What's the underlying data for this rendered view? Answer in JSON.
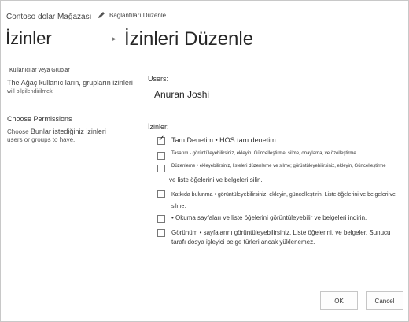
{
  "header": {
    "site_title": "Contoso dolar Mağazası",
    "edit_links": "Bağlantıları Düzenle...",
    "page_title_left": "İzinler",
    "page_title": "İzinleri Düzenle"
  },
  "left": {
    "section1_title": "Kullanıcılar veya Gruplar",
    "section1_desc_lead": "The",
    "section1_desc_rest": "Ağaç kullanıcıların, grupların izinleri",
    "section1_desc_line2": "will bilgilendirilmek",
    "section2_title": "Choose Permissions",
    "section2_desc_lead": "Choose",
    "section2_desc_rest": "Bunlar istediğiniz izinleri",
    "section2_desc_line2": "users or groups to have."
  },
  "form": {
    "users_label": "Users:",
    "users_value": "Anuran Joshi",
    "permissions_label": "İzinler:",
    "permissions": [
      {
        "text": "Tam Denetim • HOS tam denetim.",
        "checked": true
      },
      {
        "text": "Tasarım - görüntüleyebilirsiniz, ekleyin, Güncelleştirme, silme, onaylama, ve özelleştirme",
        "checked": false
      },
      {
        "text": "Düzenleme • ekleyebilirsiniz, listeleri düzenleme ve silme; görüntüleyebilirsiniz, ekleyin, Güncelleştirme",
        "continuation": "ve liste öğelerini ve belgeleri silin.",
        "checked": false
      },
      {
        "text": "Katkıda bulunma • görüntüleyebilirsiniz, ekleyin, güncelleştirin. Liste öğelerini ve belgeleri ve silme.",
        "checked": false
      },
      {
        "text": "• Okuma sayfaları ve liste öğelerini görüntüleyebilir ve belgeleri indirin.",
        "checked": false
      },
      {
        "text": "Görünüm • sayfalarını görüntüleyebilirsiniz. Liste öğelerini. ve belgeler. Sunucu tarafı dosya işleyici belge türleri ancak yüklenemez.",
        "checked": false
      }
    ]
  },
  "buttons": {
    "ok": "OK",
    "cancel": "Cancel"
  }
}
